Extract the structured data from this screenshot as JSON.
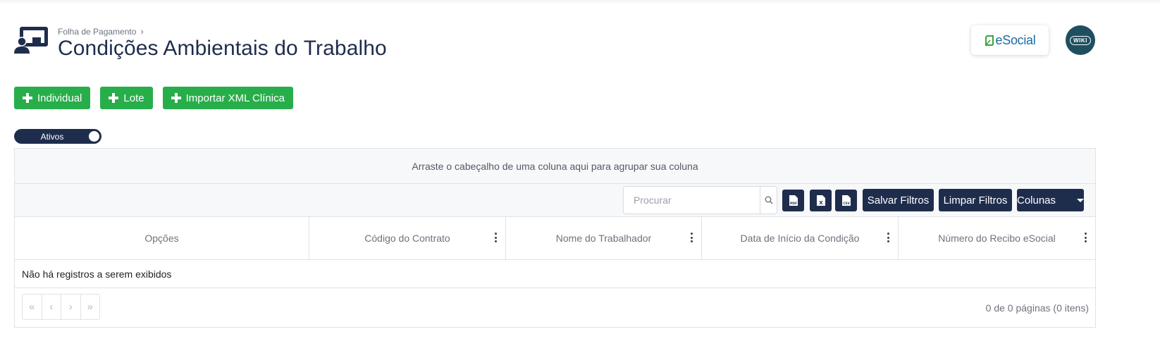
{
  "breadcrumb": {
    "parent": "Folha de Pagamento",
    "separator": "›"
  },
  "page": {
    "title": "Condições Ambientais do Trabalho"
  },
  "brand": {
    "esocial": "eSocial",
    "wiki": "WIKI"
  },
  "actions": [
    {
      "label": "Individual"
    },
    {
      "label": "Lote"
    },
    {
      "label": "Importar XML Clínica"
    }
  ],
  "toggle": {
    "label": "Ativos",
    "on": true
  },
  "grid": {
    "group_hint": "Arraste o cabeçalho de uma coluna aqui para agrupar sua coluna",
    "search": {
      "placeholder": "Procurar",
      "value": ""
    },
    "exports": [
      "PDF",
      "X",
      "CSV"
    ],
    "save_filters": "Salvar Filtros",
    "clear_filters": "Limpar Filtros",
    "columns_button": "Colunas",
    "columns": [
      {
        "label": "Opções"
      },
      {
        "label": "Código do Contrato"
      },
      {
        "label": "Nome do Trabalhador"
      },
      {
        "label": "Data de Início da Condição"
      },
      {
        "label": "Número do Recibo eSocial"
      }
    ],
    "empty_message": "Não há registros a serem exibidos",
    "pager": {
      "first": "«",
      "prev": "‹",
      "next": "›",
      "last": "»",
      "info": "0 de 0 páginas (0 itens)"
    }
  },
  "colors": {
    "navy": "#1f2d4d",
    "green": "#27ae4a",
    "esocial_blue": "#1d6ba3",
    "esocial_green": "#3aa33a"
  }
}
